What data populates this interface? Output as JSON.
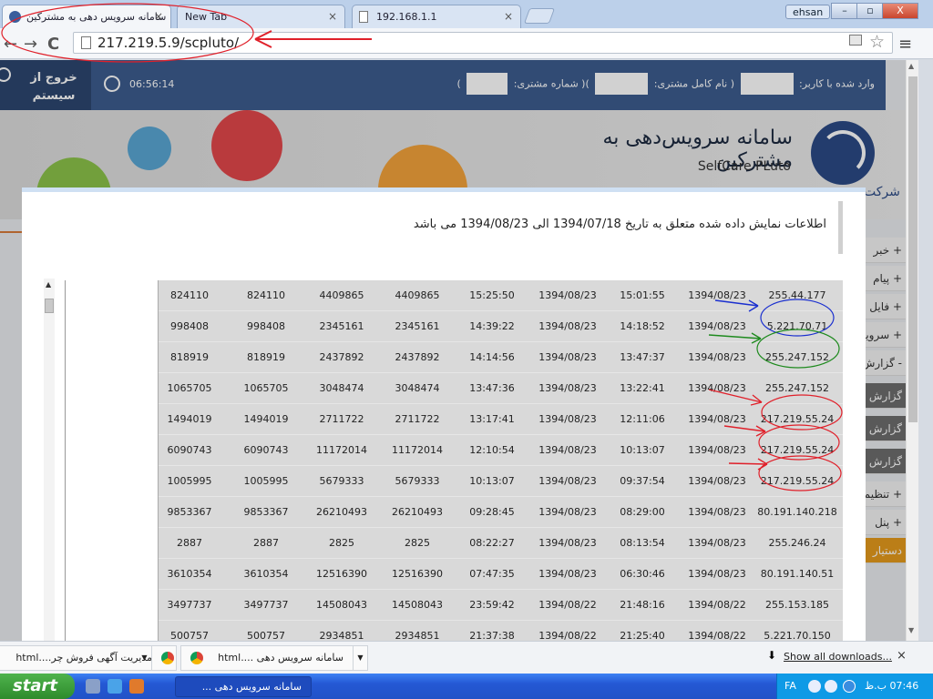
{
  "browser": {
    "tabs": [
      {
        "title": "سامانه سرویس دهی به مشترکین",
        "active": true
      },
      {
        "title": "New Tab",
        "active": false
      },
      {
        "title": "192.168.1.1",
        "active": false
      }
    ],
    "tab_close": "×",
    "user": "ehsan",
    "window_buttons": {
      "minimize": "–",
      "restore": "▫",
      "close": "X"
    },
    "url": "217.219.5.9/scpluto/",
    "nav": {
      "back": "←",
      "forward": "→",
      "reload": "C"
    },
    "star": "☆",
    "menu": "≡"
  },
  "site": {
    "logout_label": "خروج از سیستم",
    "time": "06:56:14",
    "user_info": {
      "logged_in_label": "وارد شده با کاربر:",
      "full_name_label": "( نام کامل مشتری:",
      "customer_number_label": ")( شماره مشتری:",
      "closing": ")"
    },
    "banner_title": "سامانه سرویس‌دهی به مشترکین",
    "banner_subtitle": "SelfCare PLuto",
    "company": "شرکت"
  },
  "right_nav": [
    {
      "label": "+ خبر"
    },
    {
      "label": "+ پیام"
    },
    {
      "label": "+ فایل"
    },
    {
      "label": "+ سرویس"
    },
    {
      "label": "- گزارش"
    },
    {
      "label": "گزارش",
      "style": "dark"
    },
    {
      "label": "گزارش",
      "style": "dark"
    },
    {
      "label": "گزارش",
      "style": "dark"
    },
    {
      "label": "+ تنظیمات"
    },
    {
      "label": "+ پنل"
    },
    {
      "label": "دستیار",
      "style": "orange"
    }
  ],
  "modal": {
    "title": "اطلاعات نمایش داده شده متعلق به تاریخ 1394/07/18 الی 1394/08/23 می باشد",
    "rows": [
      [
        "824110",
        "824110",
        "4409865",
        "4409865",
        "15:25:50",
        "1394/08/23",
        "15:01:55",
        "1394/08/23",
        "255.44.177"
      ],
      [
        "998408",
        "998408",
        "2345161",
        "2345161",
        "14:39:22",
        "1394/08/23",
        "14:18:52",
        "1394/08/23",
        "5.221.70.71"
      ],
      [
        "818919",
        "818919",
        "2437892",
        "2437892",
        "14:14:56",
        "1394/08/23",
        "13:47:37",
        "1394/08/23",
        "255.247.152"
      ],
      [
        "1065705",
        "1065705",
        "3048474",
        "3048474",
        "13:47:36",
        "1394/08/23",
        "13:22:41",
        "1394/08/23",
        "255.247.152"
      ],
      [
        "1494019",
        "1494019",
        "2711722",
        "2711722",
        "13:17:41",
        "1394/08/23",
        "12:11:06",
        "1394/08/23",
        "217.219.55.24"
      ],
      [
        "6090743",
        "6090743",
        "11172014",
        "11172014",
        "12:10:54",
        "1394/08/23",
        "10:13:07",
        "1394/08/23",
        "217.219.55.24"
      ],
      [
        "1005995",
        "1005995",
        "5679333",
        "5679333",
        "10:13:07",
        "1394/08/23",
        "09:37:54",
        "1394/08/23",
        "217.219.55.24"
      ],
      [
        "9853367",
        "9853367",
        "26210493",
        "26210493",
        "09:28:45",
        "1394/08/23",
        "08:29:00",
        "1394/08/23",
        "80.191.140.218"
      ],
      [
        "2887",
        "2887",
        "2825",
        "2825",
        "08:22:27",
        "1394/08/23",
        "08:13:54",
        "1394/08/23",
        "255.246.24"
      ],
      [
        "3610354",
        "3610354",
        "12516390",
        "12516390",
        "07:47:35",
        "1394/08/23",
        "06:30:46",
        "1394/08/23",
        "80.191.140.51"
      ],
      [
        "3497737",
        "3497737",
        "14508043",
        "14508043",
        "23:59:42",
        "1394/08/22",
        "21:48:16",
        "1394/08/22",
        "255.153.185"
      ],
      [
        "500757",
        "500757",
        "2934851",
        "2934851",
        "21:37:38",
        "1394/08/22",
        "21:25:40",
        "1394/08/22",
        "5.221.70.150"
      ]
    ]
  },
  "downloads": {
    "items": [
      {
        "label": "مدیریت آگهی فروش چر....html"
      },
      {
        "label": "سامانه سرویس دهی ....html"
      }
    ],
    "show_all": "Show all downloads...",
    "close": "×"
  },
  "taskbar": {
    "start": "start",
    "item": "سامانه سرویس دهی ...",
    "lang": "FA",
    "clock": "07:46 ب.ظ"
  }
}
